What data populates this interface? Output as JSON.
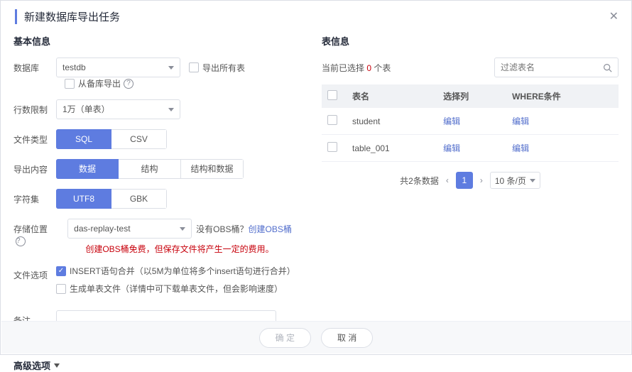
{
  "modal": {
    "title": "新建数据库导出任务"
  },
  "left": {
    "section_title": "基本信息",
    "labels": {
      "database": "数据库",
      "row_limit": "行数限制",
      "file_type": "文件类型",
      "export_content": "导出内容",
      "charset": "字符集",
      "storage": "存储位置",
      "file_option": "文件选项",
      "remark": "备注"
    },
    "database_value": "testdb",
    "export_all_tables": "导出所有表",
    "from_backup": "从备库导出",
    "row_limit_value": "1万（单表）",
    "file_type": {
      "sql": "SQL",
      "csv": "CSV"
    },
    "export_content": {
      "data": "数据",
      "structure": "结构",
      "both": "结构和数据"
    },
    "charset": {
      "utf8": "UTF8",
      "gbk": "GBK"
    },
    "storage_value": "das-replay-test",
    "obs_missing": "没有OBS桶？",
    "obs_create_link": "创建OBS桶",
    "obs_warning": "创建OBS桶免费，但保存文件将产生一定的费用。",
    "file_opts": {
      "insert_merge": "INSERT语句合并（以5M为单位将多个insert语句进行合并）",
      "single_table": "生成单表文件（详情中可下载单表文件，但会影响速度）"
    },
    "advanced": "高级选项"
  },
  "right": {
    "section_title": "表信息",
    "selected_prefix": "当前已选择 ",
    "selected_count": "0",
    "selected_suffix": " 个表",
    "filter_placeholder": "过滤表名",
    "cols": {
      "name": "表名",
      "select_col": "选择列",
      "where": "WHERE条件"
    },
    "edit_label": "编辑",
    "rows": [
      {
        "name": "student"
      },
      {
        "name": "table_001"
      }
    ],
    "pagination": {
      "total_text": "共2条数据",
      "page": "1",
      "page_size": "10 条/页"
    }
  },
  "footer": {
    "confirm": "确 定",
    "cancel": "取 消"
  }
}
